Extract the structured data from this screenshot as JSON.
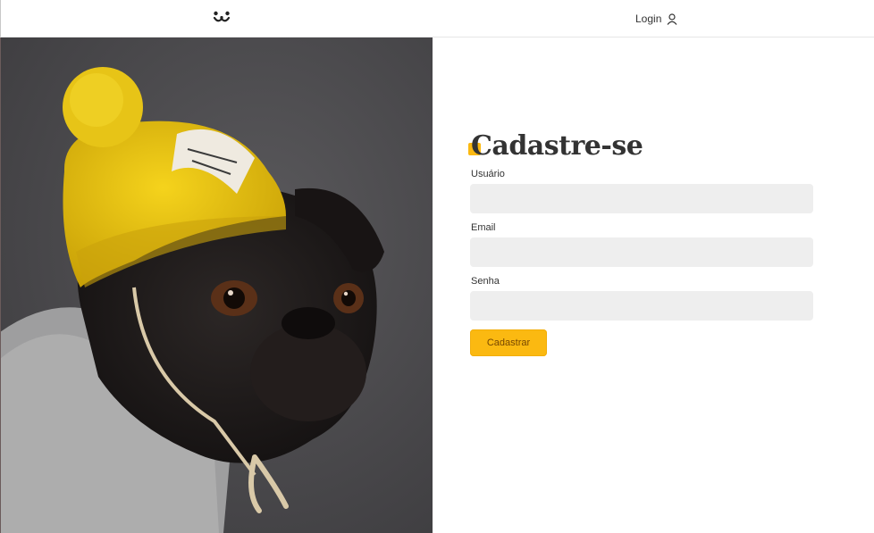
{
  "header": {
    "logo_name": "dogs-logo-icon",
    "login_label": "Login",
    "login_icon": "user-icon"
  },
  "photo": {
    "alt": "pug wearing yellow beanie and grey sweater",
    "icon": "dog-photo"
  },
  "form": {
    "title": "Cadastre-se",
    "fields": [
      {
        "label": "Usuário",
        "value": "",
        "placeholder": ""
      },
      {
        "label": "Email",
        "value": "",
        "placeholder": ""
      },
      {
        "label": "Senha",
        "value": "",
        "placeholder": ""
      }
    ],
    "submit_label": "Cadastrar"
  },
  "colors": {
    "accent": "#fbb911",
    "accent_text": "#764701",
    "input_bg": "#eeeeee",
    "text": "#333333"
  }
}
